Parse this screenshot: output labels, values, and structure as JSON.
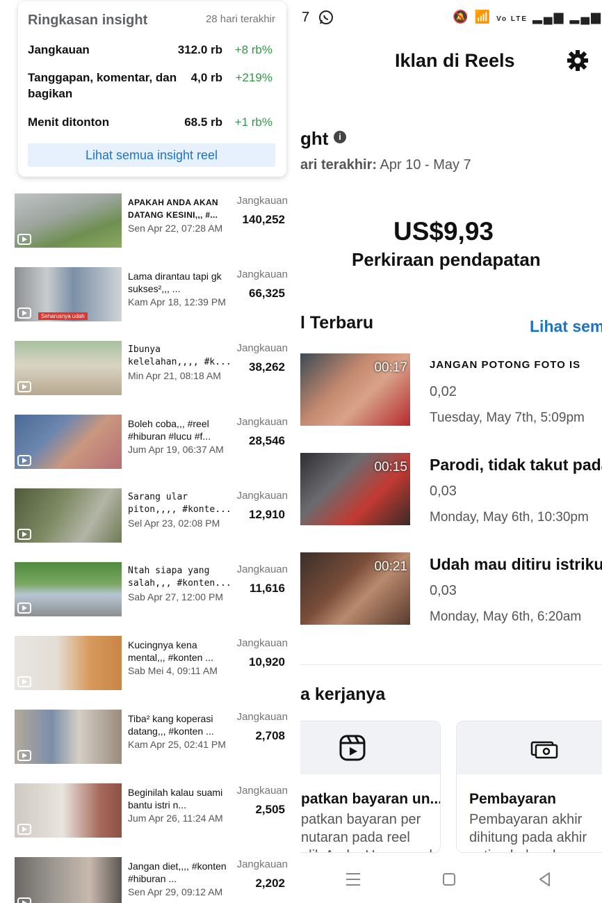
{
  "summary": {
    "title": "Ringkasan insight",
    "period": "28 hari terakhir",
    "metrics": [
      {
        "label": "Jangkauan",
        "value": "312.0 rb",
        "change": "+8 rb%"
      },
      {
        "label": "Tanggapan, komentar, dan bagikan",
        "value": "4,0 rb",
        "change": "+219%"
      },
      {
        "label": "Menit ditonton",
        "value": "68.5 rb",
        "change": "+1 rb%"
      }
    ],
    "see_all": "Lihat semua insight reel"
  },
  "reels": [
    {
      "title": "APAKAH ANDA AKAN DATANG KESINI,,, #...",
      "date": "Sen Apr 22, 07:28 AM",
      "metric_label": "Jangkauan",
      "metric_value": "140,252"
    },
    {
      "title": "Lama dirantau tapi gk sukses²,,, ...",
      "date": "Kam Apr 18, 12:39 PM",
      "metric_label": "Jangkauan",
      "metric_value": "66,325",
      "thumb_caption": "Seharusnya udah"
    },
    {
      "title": "Ibunya kelelahan,,,, #k...",
      "date": "Min Apr 21, 08:18 AM",
      "metric_label": "Jangkauan",
      "metric_value": "38,262"
    },
    {
      "title": "Boleh coba,,, #reel #hiburan #lucu #f...",
      "date": "Jum Apr 19, 06:37 AM",
      "metric_label": "Jangkauan",
      "metric_value": "28,546"
    },
    {
      "title": "Sarang ular piton,,,, #konte...",
      "date": "Sel Apr 23, 02:08 PM",
      "metric_label": "Jangkauan",
      "metric_value": "12,910"
    },
    {
      "title": "Ntah siapa yang salah,,, #konten...",
      "date": "Sab Apr 27, 12:00 PM",
      "metric_label": "Jangkauan",
      "metric_value": "11,616"
    },
    {
      "title": "Kucingnya kena mental,,, #konten ...",
      "date": "Sab Mei 4, 09:11 AM",
      "metric_label": "Jangkauan",
      "metric_value": "10,920"
    },
    {
      "title": "Tiba² kang koperasi datang,,, #konten ...",
      "date": "Kam Apr 25, 02:41 PM",
      "metric_label": "Jangkauan",
      "metric_value": "2,708"
    },
    {
      "title": "Beginilah kalau suami bantu istri n...",
      "date": "Jum Apr 26, 11:24 AM",
      "metric_label": "Jangkauan",
      "metric_value": "2,505"
    },
    {
      "title": "Jangan diet,,,, #konten #hiburan ...",
      "date": "Sen Apr 29, 09:12 AM",
      "metric_label": "Jangkauan",
      "metric_value": "2,202"
    }
  ],
  "right": {
    "status_time": "7",
    "status_net": "Vo LTE",
    "title": "Iklan di Reels",
    "insight_heading": "ght",
    "info_icon_glyph": "i",
    "period_label": "ari terakhir:",
    "period_range": "Apr 10 - May 7",
    "earnings": "US$9,93",
    "earnings_label": "Perkiraan pendapatan",
    "latest_heading": "l Terbaru",
    "see_all": "Lihat sem",
    "latest": [
      {
        "duration": "00:17",
        "title": "JANGAN POTONG FOTO IS",
        "value": "0,02",
        "date": "Tuesday, May 7th, 5:09pm"
      },
      {
        "duration": "00:15",
        "title": "Parodi, tidak takut pada",
        "value": "0,03",
        "date": "Monday, May 6th, 10:30pm"
      },
      {
        "duration": "00:21",
        "title": "Udah mau ditiru istriku.",
        "value": "0,03",
        "date": "Monday, May 6th, 6:20am"
      }
    ],
    "how_heading": "a kerjanya",
    "cards": [
      {
        "title": "patkan bayaran un...",
        "desc": [
          "patkan bayaran per",
          "nutaran pada reel",
          "alik Anda. Hanya reel"
        ]
      },
      {
        "title": "Pembayaran",
        "desc": [
          "Pembayaran akhir",
          "dihitung pada akhir",
          "setiap bulan dan"
        ]
      }
    ]
  },
  "colors": {
    "accent": "#1a73c9",
    "positive": "#2e9a43",
    "muted": "#757575"
  }
}
